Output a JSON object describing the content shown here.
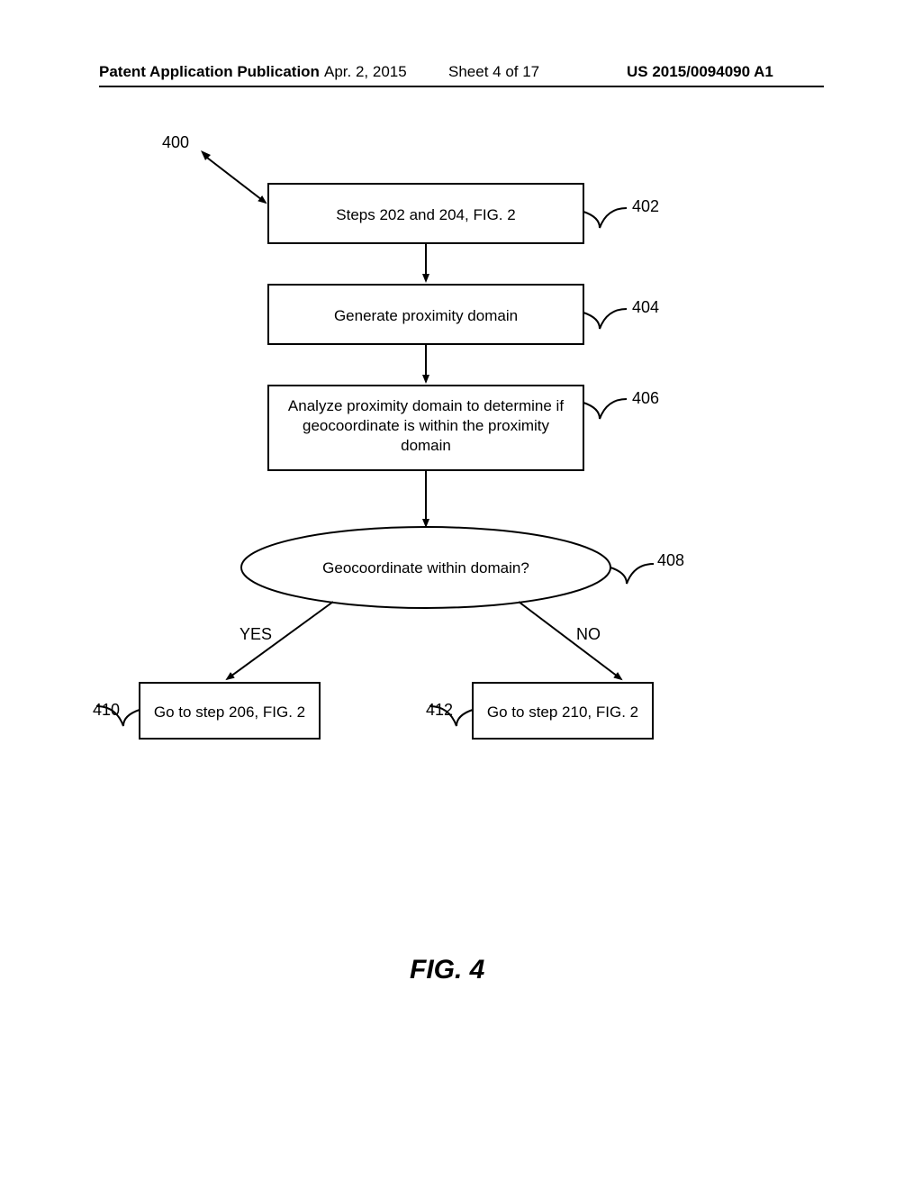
{
  "header": {
    "publication": "Patent Application Publication",
    "date": "Apr. 2, 2015",
    "sheet": "Sheet 4 of 17",
    "docnum": "US 2015/0094090 A1"
  },
  "diagram": {
    "pointer_ref": "400",
    "box_402": {
      "text": "Steps 202 and 204, FIG. 2",
      "ref": "402"
    },
    "box_404": {
      "text": "Generate proximity domain",
      "ref": "404"
    },
    "box_406": {
      "text": "Analyze proximity domain to determine if geocoordinate is within the proximity domain",
      "ref": "406"
    },
    "decision_408": {
      "text": "Geocoordinate within domain?",
      "ref": "408"
    },
    "branch_yes": "YES",
    "branch_no": "NO",
    "box_410": {
      "text": "Go to step 206, FIG. 2",
      "ref": "410"
    },
    "box_412": {
      "text": "Go to step 210, FIG. 2",
      "ref": "412"
    }
  },
  "figure_title": "FIG. 4"
}
